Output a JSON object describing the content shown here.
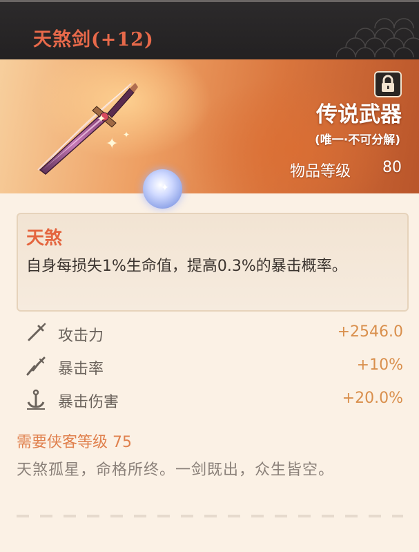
{
  "header": {
    "title": "天煞剑(+12)"
  },
  "banner": {
    "quality": "传说武器",
    "quality_note": "(唯一·不可分解)",
    "item_level_label": "物品等级",
    "item_level_value": "80",
    "lock_icon": "lock-icon"
  },
  "passive": {
    "name": "天煞",
    "description": "自身每损失1%生命值，提高0.3%的暴击概率。"
  },
  "stats": [
    {
      "icon": "sword-icon",
      "label": "攻击力",
      "value": "+2546.0"
    },
    {
      "icon": "crit-icon",
      "label": "暴击率",
      "value": "+10%"
    },
    {
      "icon": "anchor-icon",
      "label": "暴击伤害",
      "value": "+20.0%"
    }
  ],
  "requirement": "需要侠客等级 75",
  "lore": "天煞孤星，命格所终。一剑既出，众生皆空。",
  "colors": {
    "title": "#e7694a",
    "passive_name": "#e4653f",
    "stat_value": "#d98f4c",
    "requirement": "#e0814e"
  }
}
